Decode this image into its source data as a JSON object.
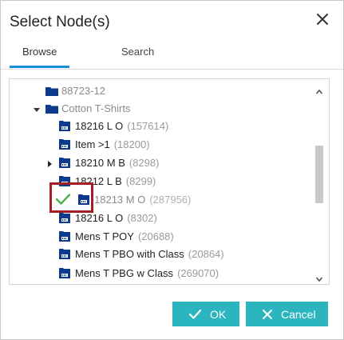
{
  "dialog": {
    "title": "Select Node(s)",
    "close_icon": "close-icon"
  },
  "tabs": [
    {
      "label": "Browse",
      "active": true
    },
    {
      "label": "Search",
      "active": false
    }
  ],
  "tree": {
    "rows": [
      {
        "label": "88723-12",
        "count": "",
        "kind": "folder",
        "expander": "none",
        "muted": true
      },
      {
        "label": "Cotton T-Shirts",
        "count": "",
        "kind": "folder",
        "expander": "expanded",
        "muted": true
      },
      {
        "label": "18216 L O",
        "count": "(157614)",
        "kind": "node",
        "expander": "none",
        "muted": false
      },
      {
        "label": "Item >1",
        "count": "(18200)",
        "kind": "node",
        "expander": "none",
        "muted": false
      },
      {
        "label": "18210 M B",
        "count": "(8298)",
        "kind": "node",
        "expander": "collapsed",
        "muted": false
      },
      {
        "label": "18212 L B",
        "count": "(8299)",
        "kind": "node",
        "expander": "none",
        "muted": false
      },
      {
        "label": "18213 M O",
        "count": "(287956)",
        "kind": "node",
        "expander": "none",
        "muted": true,
        "selected": true
      },
      {
        "label": "18216 L O",
        "count": "(8302)",
        "kind": "node",
        "expander": "none",
        "muted": false
      },
      {
        "label": "Mens T POY",
        "count": "(20688)",
        "kind": "node",
        "expander": "none",
        "muted": false
      },
      {
        "label": "Mens T PBO with Class",
        "count": "(20864)",
        "kind": "node",
        "expander": "none",
        "muted": false
      },
      {
        "label": "Mens T PBG w Class",
        "count": "(269070)",
        "kind": "node",
        "expander": "none",
        "muted": false
      }
    ]
  },
  "buttons": {
    "ok_label": "OK",
    "cancel_label": "Cancel"
  },
  "colors": {
    "accent": "#2bb5be",
    "tab_underline": "#1a8fd8",
    "icon_blue": "#0d3a8c",
    "check_green": "#4caf50",
    "highlight_red": "#a31e22"
  }
}
